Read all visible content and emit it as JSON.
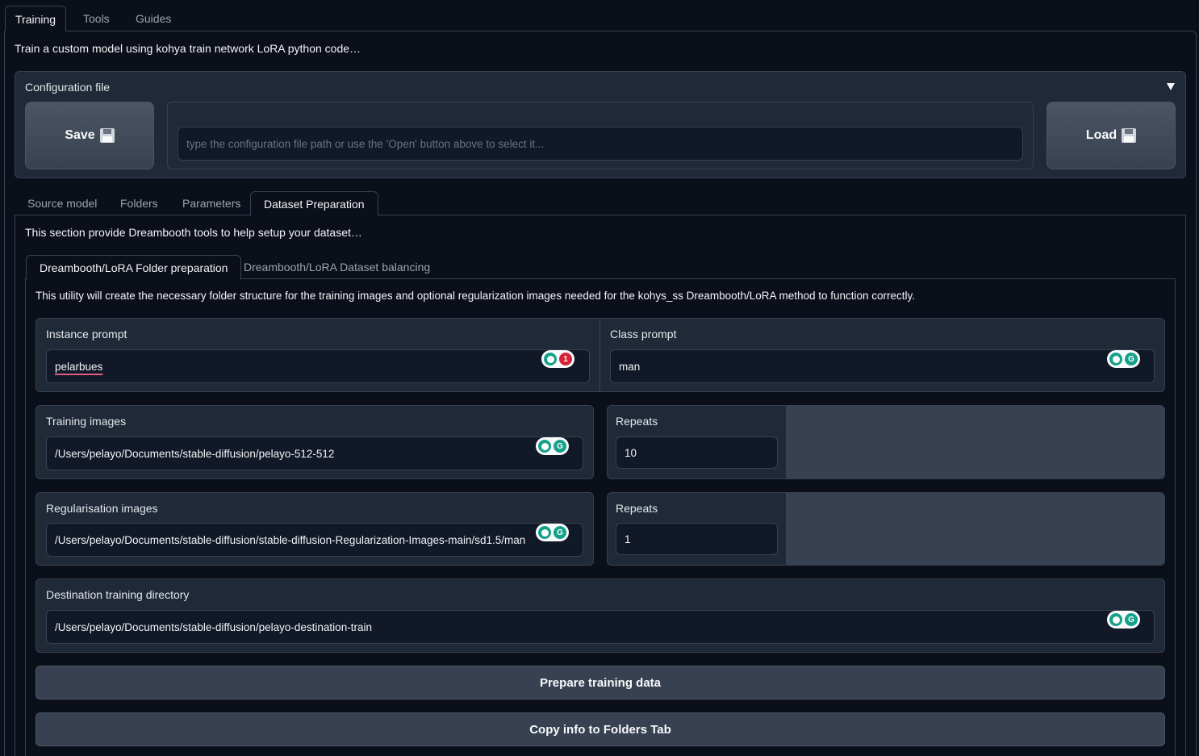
{
  "top_tabs": [
    {
      "label": "Training",
      "active": true
    },
    {
      "label": "Tools",
      "active": false
    },
    {
      "label": "Guides",
      "active": false
    }
  ],
  "page_description": "Train a custom model using kohya train network LoRA python code…",
  "config": {
    "title": "Configuration file",
    "save_label": "Save",
    "load_label": "Load",
    "path_placeholder": "type the configuration file path or use the 'Open' button above to select it..."
  },
  "sub_tabs": [
    {
      "label": "Source model",
      "active": false
    },
    {
      "label": "Folders",
      "active": false
    },
    {
      "label": "Parameters",
      "active": false
    },
    {
      "label": "Dataset Preparation",
      "active": true
    }
  ],
  "dataset_description": "This section provide Dreambooth tools to help setup your dataset…",
  "inner_tabs": [
    {
      "label": "Dreambooth/LoRA Folder preparation",
      "active": true
    },
    {
      "label": "Dreambooth/LoRA Dataset balancing",
      "active": false
    }
  ],
  "utility_description": "This utility will create the necessary folder structure for the training images and optional regularization images needed for the kohys_ss Dreambooth/LoRA method to function correctly.",
  "fields": {
    "instance_prompt": {
      "label": "Instance prompt",
      "value": "pelarbues",
      "badge_count": "1"
    },
    "class_prompt": {
      "label": "Class prompt",
      "value": "man"
    },
    "training_images": {
      "label": "Training images",
      "value": "/Users/pelayo/Documents/stable-diffusion/pelayo-512-512"
    },
    "training_repeats": {
      "label": "Repeats",
      "value": "10"
    },
    "reg_images": {
      "label": "Regularisation images",
      "value": "/Users/pelayo/Documents/stable-diffusion/stable-diffusion-Regularization-Images-main/sd1.5/man"
    },
    "reg_repeats": {
      "label": "Repeats",
      "value": "1"
    },
    "destination": {
      "label": "Destination training directory",
      "value": "/Users/pelayo/Documents/stable-diffusion/pelayo-destination-train"
    }
  },
  "actions": {
    "prepare_label": "Prepare training data",
    "copy_label": "Copy info to Folders Tab"
  },
  "colors": {
    "background": "#0b0f19",
    "panel": "#1f2937",
    "grammarly_green": "#15a08a",
    "grammarly_red": "#d3233a"
  }
}
